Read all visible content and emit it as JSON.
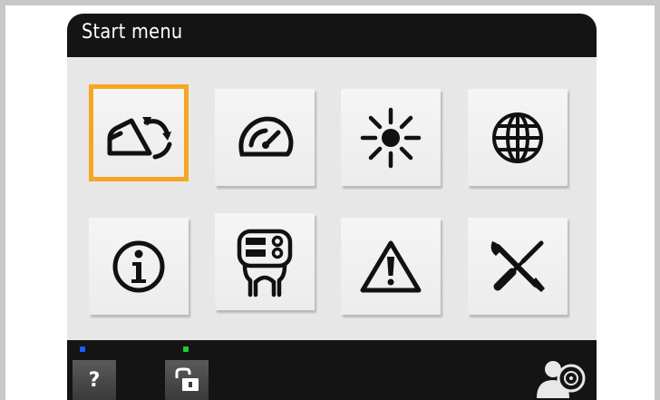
{
  "title": "Start menu",
  "tiles": [
    {
      "icon": "machine-rotate-icon",
      "selected": true
    },
    {
      "icon": "speedometer-icon",
      "selected": false
    },
    {
      "icon": "brightness-icon",
      "selected": false
    },
    {
      "icon": "globe-icon",
      "selected": false
    },
    {
      "icon": "info-icon",
      "selected": false
    },
    {
      "icon": "controller-icon",
      "selected": false
    },
    {
      "icon": "warning-icon",
      "selected": false
    },
    {
      "icon": "tools-icon",
      "selected": false
    }
  ],
  "bottom_bar": {
    "help_label": "?",
    "help_led_color": "#1f5cff",
    "lock_led_color": "#22cc33",
    "lock_icon": "unlock-icon",
    "user_icon": "user-settings-icon"
  },
  "colors": {
    "selection": "#f5a623",
    "bar": "#141414",
    "panel": "#e7e7e7"
  }
}
